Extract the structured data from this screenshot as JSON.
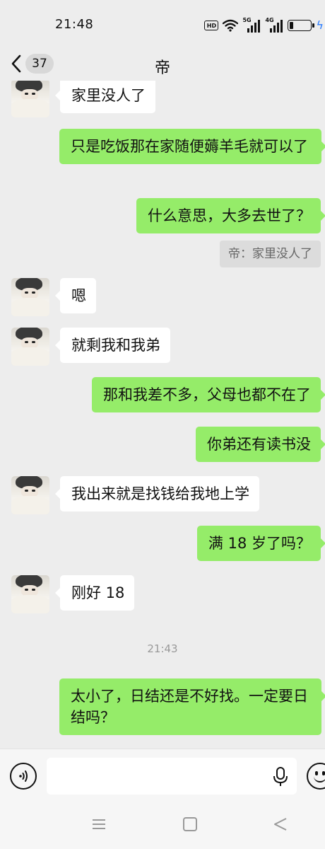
{
  "status_bar": {
    "time": "21:48",
    "hd_label": "HD",
    "sim1_label": "5G",
    "sim2_label": "4G",
    "battery_icon": "battery-low-icon",
    "charging_icon": "charging-bolt-icon"
  },
  "header": {
    "back_icon": "chevron-left-icon",
    "unread_count": "37",
    "title": "帝"
  },
  "messages": [
    {
      "side": "in",
      "text": "家里没人了"
    },
    {
      "side": "out",
      "text": "只是吃饭那在家随便薅羊毛就可以了"
    },
    {
      "side": "out",
      "text": "什么意思，大多去世了？"
    },
    {
      "quote": "帝：家里没人了"
    },
    {
      "side": "in",
      "text": "嗯"
    },
    {
      "side": "in",
      "text": "就剩我和我弟"
    },
    {
      "side": "out",
      "text": "那和我差不多，父母也都不在了"
    },
    {
      "side": "out",
      "text": "你弟还有读书没"
    },
    {
      "side": "in",
      "text": "我出来就是找钱给我地上学"
    },
    {
      "side": "out",
      "text": "满 18 岁了吗？"
    },
    {
      "side": "in",
      "text": "刚好 18"
    },
    {
      "timestamp": "21:43"
    },
    {
      "side": "out",
      "text": "太小了，日结还是不好找。一定要日结吗？"
    }
  ],
  "input_bar": {
    "voice_icon": "voice-mode-icon",
    "value": "",
    "mic_icon": "microphone-icon",
    "emoji_icon": "emoji-icon"
  },
  "nav_bar": {
    "menu_icon": "menu-icon",
    "home_icon": "home-icon",
    "back_icon": "back-triangle-icon"
  },
  "colors": {
    "background": "#ededed",
    "outgoing_bubble": "#95ec69",
    "incoming_bubble": "#ffffff",
    "charging_bolt": "#2a7cff"
  }
}
